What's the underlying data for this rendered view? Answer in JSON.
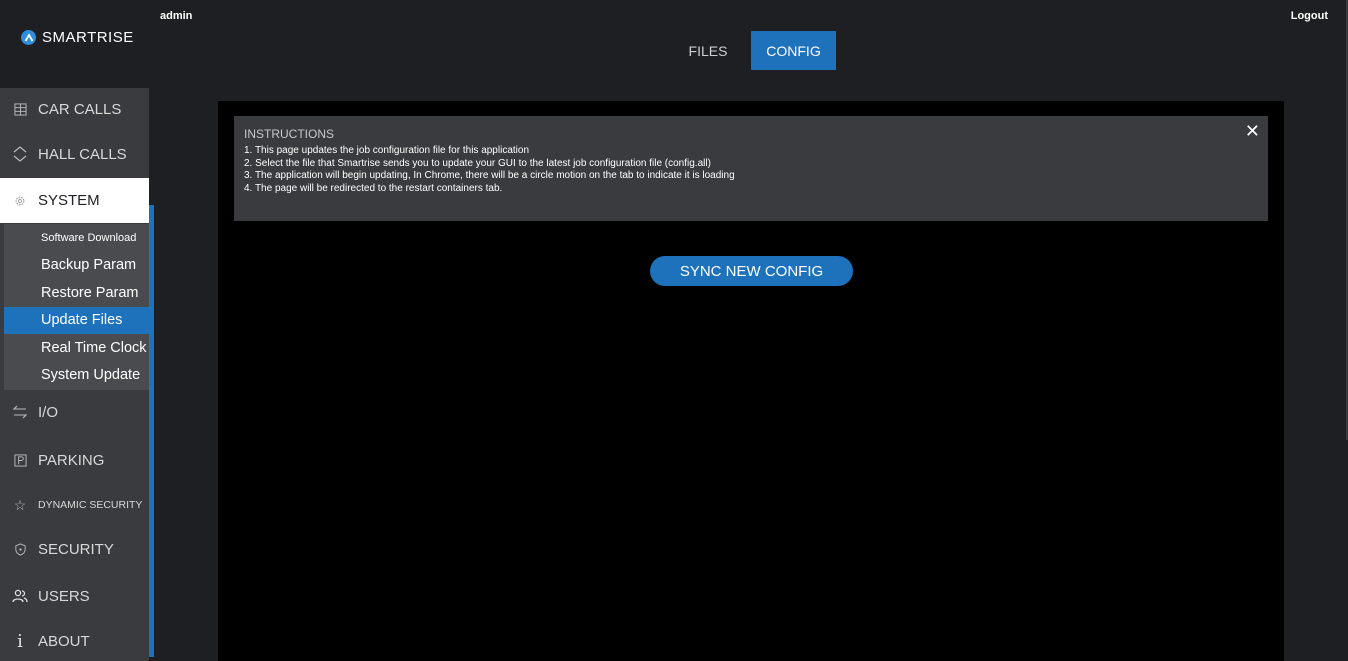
{
  "header": {
    "user": "admin",
    "logout_label": "Logout"
  },
  "brand": {
    "name": "SMARTRISE",
    "color": "#2f8ddb"
  },
  "sidebar": {
    "items": [
      {
        "label": "CAR CALLS",
        "icon": "grid-icon"
      },
      {
        "label": "HALL CALLS",
        "icon": "up-down-chevron-icon"
      },
      {
        "label": "SYSTEM",
        "icon": "gear-icon"
      },
      {
        "label": "I/O",
        "icon": "swap-arrows-icon"
      },
      {
        "label": "PARKING",
        "icon": "parking-icon"
      },
      {
        "label": "DYNAMIC SECURITY",
        "icon": "star-icon"
      },
      {
        "label": "SECURITY",
        "icon": "shield-icon"
      },
      {
        "label": "USERS",
        "icon": "users-icon"
      },
      {
        "label": "ABOUT",
        "icon": "info-icon"
      }
    ],
    "submenu": [
      {
        "label": "Software Download"
      },
      {
        "label": "Backup Param"
      },
      {
        "label": "Restore Param"
      },
      {
        "label": "Update Files"
      },
      {
        "label": "Real Time Clock"
      },
      {
        "label": "System Update"
      }
    ]
  },
  "tabs": [
    {
      "label": "FILES"
    },
    {
      "label": "CONFIG"
    }
  ],
  "instructions": {
    "title": "INSTRUCTIONS",
    "lines": [
      "1. This page updates the job configuration file for this application",
      "2. Select the file that Smartrise sends you to update your GUI to the latest job configuration file (config.all)",
      "3. The application will begin updating, In Chrome, there will be a circle motion on the tab to indicate it is loading",
      "4. The page will be redirected to the restart containers tab."
    ]
  },
  "actions": {
    "sync_label": "SYNC NEW CONFIG"
  },
  "colors": {
    "accent": "#1d72bb",
    "background": "#1e1f22",
    "panel": "#000000",
    "sidebar": "#3a3b3e"
  }
}
